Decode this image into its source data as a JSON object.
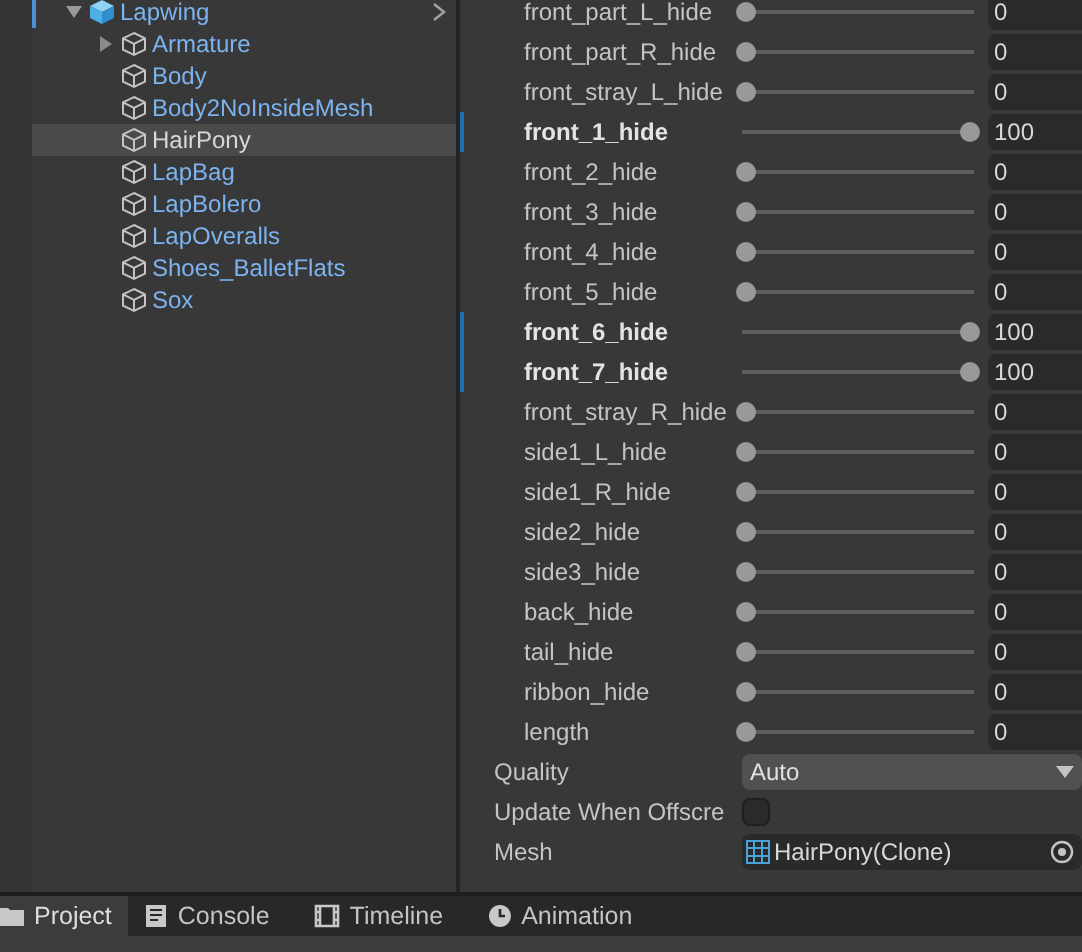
{
  "hierarchy": {
    "root": {
      "label": "Lapwing",
      "expanded": true,
      "children": [
        {
          "label": "Armature",
          "has_children": true,
          "selected": false
        },
        {
          "label": "Body",
          "has_children": false,
          "selected": false
        },
        {
          "label": "Body2NoInsideMesh",
          "has_children": false,
          "selected": false
        },
        {
          "label": "HairPony",
          "has_children": false,
          "selected": true
        },
        {
          "label": "LapBag",
          "has_children": false,
          "selected": false
        },
        {
          "label": "LapBolero",
          "has_children": false,
          "selected": false
        },
        {
          "label": "LapOveralls",
          "has_children": false,
          "selected": false
        },
        {
          "label": "Shoes_BalletFlats",
          "has_children": false,
          "selected": false
        },
        {
          "label": "Sox",
          "has_children": false,
          "selected": false
        }
      ]
    }
  },
  "blend_shapes": [
    {
      "name": "front_part_L_hide",
      "level": 0,
      "value": "0",
      "overridden": false
    },
    {
      "name": "front_part_R_hide",
      "level": 0,
      "value": "0",
      "overridden": false
    },
    {
      "name": "front_stray_L_hide",
      "level": 0,
      "value": "0",
      "overridden": false
    },
    {
      "name": "front_1_hide",
      "level": 1,
      "value": "100",
      "overridden": true
    },
    {
      "name": "front_2_hide",
      "level": 0,
      "value": "0",
      "overridden": false
    },
    {
      "name": "front_3_hide",
      "level": 0,
      "value": "0",
      "overridden": false
    },
    {
      "name": "front_4_hide",
      "level": 0,
      "value": "0",
      "overridden": false
    },
    {
      "name": "front_5_hide",
      "level": 0,
      "value": "0",
      "overridden": false
    },
    {
      "name": "front_6_hide",
      "level": 1,
      "value": "100",
      "overridden": true
    },
    {
      "name": "front_7_hide",
      "level": 1,
      "value": "100",
      "overridden": true
    },
    {
      "name": "front_stray_R_hide",
      "level": 0,
      "value": "0",
      "overridden": false
    },
    {
      "name": "side1_L_hide",
      "level": 0,
      "value": "0",
      "overridden": false
    },
    {
      "name": "side1_R_hide",
      "level": 0,
      "value": "0",
      "overridden": false
    },
    {
      "name": "side2_hide",
      "level": 0,
      "value": "0",
      "overridden": false
    },
    {
      "name": "side3_hide",
      "level": 0,
      "value": "0",
      "overridden": false
    },
    {
      "name": "back_hide",
      "level": 0,
      "value": "0",
      "overridden": false
    },
    {
      "name": "tail_hide",
      "level": 0,
      "value": "0",
      "overridden": false
    },
    {
      "name": "ribbon_hide",
      "level": 0,
      "value": "0",
      "overridden": false
    },
    {
      "name": "length",
      "level": 0,
      "value": "0",
      "overridden": false
    }
  ],
  "properties": [
    {
      "kind": "dropdown",
      "label": "Quality",
      "value": "Auto"
    },
    {
      "kind": "checkbox",
      "label": "Update When Offscre",
      "checked": false
    },
    {
      "kind": "object",
      "label": "Mesh",
      "value": "HairPony(Clone)"
    }
  ],
  "bottom_tabs": [
    {
      "label": "Project",
      "selected": true
    },
    {
      "label": "Console",
      "selected": false
    },
    {
      "label": "Timeline",
      "selected": false
    },
    {
      "label": "Animation",
      "selected": false
    }
  ]
}
